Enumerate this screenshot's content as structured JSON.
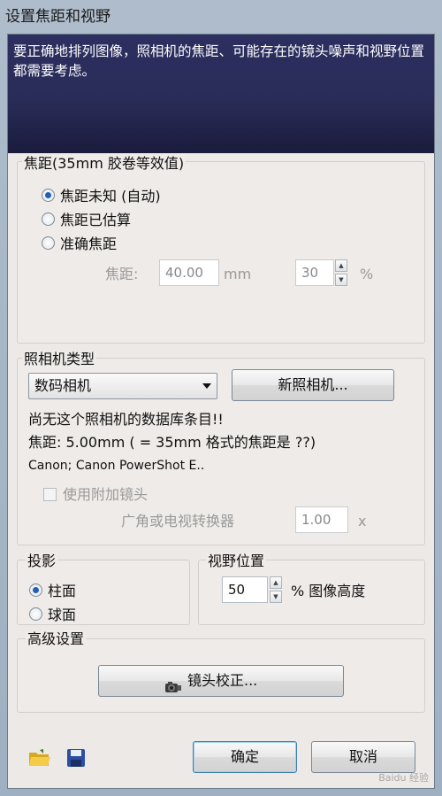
{
  "window": {
    "title": "设置焦距和视野",
    "description": "要正确地排列图像，照相机的焦距、可能存在的镜头噪声和视野位置都需要考虑。"
  },
  "focal": {
    "group_label": "焦距(35mm 胶卷等效值)",
    "options": [
      "焦距未知 (自动)",
      "焦距已估算",
      "准确焦距"
    ],
    "selected": 0,
    "label": "焦距:",
    "value": "40.00",
    "unit": "mm",
    "percent_value": "30",
    "percent_unit": "%"
  },
  "camera": {
    "group_label": "照相机类型",
    "selected_type": "数码相机",
    "new_camera_button": "新照相机...",
    "info_line1": "尚无这个照相机的数据库条目!!",
    "info_line2": "焦距: 5.00mm ( = 35mm 格式的焦距是 ??)",
    "model": "Canon; Canon PowerShot E..",
    "use_lens_label": "使用附加镜头",
    "converter_label": "广角或电视转换器",
    "converter_value": "1.00",
    "converter_unit": "x"
  },
  "projection": {
    "group_label": "投影",
    "options": [
      "柱面",
      "球面"
    ],
    "selected": 0
  },
  "view": {
    "group_label": "视野位置",
    "value": "50",
    "suffix": "% 图像高度"
  },
  "advanced": {
    "group_label": "高级设置",
    "lens_button": "镜头校正..."
  },
  "footer": {
    "ok": "确定",
    "cancel": "取消",
    "watermark": "Baidu 经验"
  },
  "icons": {
    "open": "folder-open-icon",
    "save": "floppy-disk-icon",
    "lens": "camera-lens-icon"
  }
}
